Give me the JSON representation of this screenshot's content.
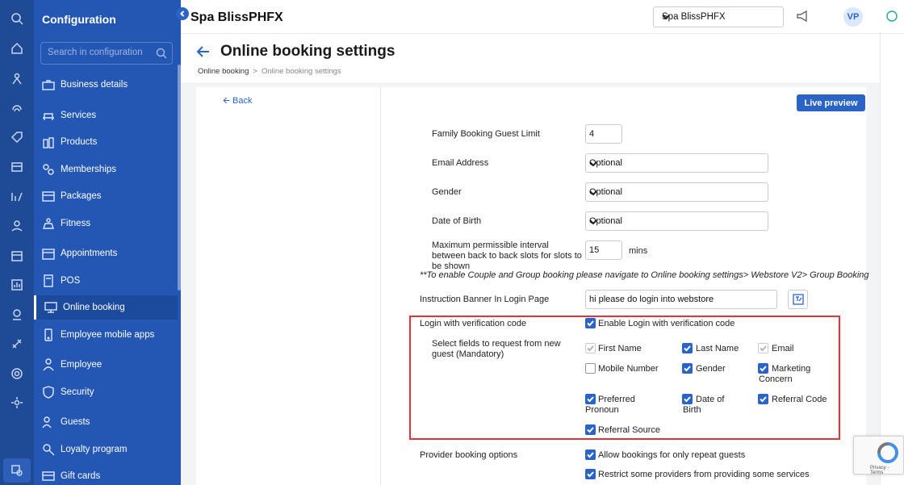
{
  "sidebar": {
    "title": "Configuration",
    "search_placeholder": "Search in configuration",
    "items": [
      {
        "label": "Business details",
        "icon": "briefcase-icon"
      },
      {
        "label": "Services",
        "icon": "services-icon"
      },
      {
        "label": "Products",
        "icon": "products-icon"
      },
      {
        "label": "Memberships",
        "icon": "memberships-icon"
      },
      {
        "label": "Packages",
        "icon": "packages-icon"
      },
      {
        "label": "Fitness",
        "icon": "fitness-icon"
      },
      {
        "label": "Appointments",
        "icon": "calendar-icon"
      },
      {
        "label": "POS",
        "icon": "pos-icon"
      },
      {
        "label": "Online booking",
        "icon": "monitor-icon"
      },
      {
        "label": "Employee mobile apps",
        "icon": "mobile-apps-icon"
      },
      {
        "label": "Employee",
        "icon": "employee-icon"
      },
      {
        "label": "Security",
        "icon": "shield-icon"
      },
      {
        "label": "Guests",
        "icon": "guests-icon"
      },
      {
        "label": "Loyalty program",
        "icon": "loyalty-icon"
      },
      {
        "label": "Gift cards",
        "icon": "gift-card-icon"
      }
    ],
    "active_item": "Online booking"
  },
  "header": {
    "brand": "Spa BlissPHFX",
    "location_select": "Spa BlissPHFX",
    "avatar_initials": "VP"
  },
  "page": {
    "title": "Online booking settings",
    "breadcrumb": [
      "Online booking",
      "Online booking settings"
    ],
    "back_link": "Back",
    "live_preview": "Live preview"
  },
  "form": {
    "family_limit": {
      "label": "Family Booking Guest Limit",
      "value": "4"
    },
    "email": {
      "label": "Email Address",
      "value": "Optional"
    },
    "gender": {
      "label": "Gender",
      "value": "Optional"
    },
    "dob": {
      "label": "Date of Birth",
      "value": "Optional"
    },
    "interval": {
      "label": "Maximum permissible interval between back to back slots for slots to be shown",
      "value": "15",
      "unit": "mins"
    },
    "note": "**To enable Couple and Group booking please navigate to Online booking settings> Webstore V2> Group Booking",
    "banner": {
      "label": "Instruction Banner In Login Page",
      "value": "hi please do login into webstore"
    },
    "login_verification": {
      "label": "Login with verification code",
      "enable_label": "Enable Login with verification code",
      "fields_label": "Select fields to request from new guest (Mandatory)",
      "fields": [
        {
          "label": "First Name",
          "state": "disabled"
        },
        {
          "label": "Last Name",
          "state": "checked"
        },
        {
          "label": "Email",
          "state": "disabled"
        },
        {
          "label": "Mobile Number",
          "state": "unchecked"
        },
        {
          "label": "Gender",
          "state": "checked"
        },
        {
          "label": "Marketing Concern",
          "state": "checked"
        },
        {
          "label": "Preferred Pronoun",
          "state": "checked"
        },
        {
          "label": "Date of Birth",
          "state": "checked"
        },
        {
          "label": "Referral Code",
          "state": "checked"
        },
        {
          "label": "Referral Source",
          "state": "checked"
        }
      ]
    },
    "provider": {
      "label": "Provider booking options",
      "opt1": "Allow bookings for only repeat guests",
      "opt2": "Restrict some providers from providing some services"
    }
  },
  "recaptcha": {
    "text": "Privacy - Terms"
  },
  "colors": {
    "sidebar": "#2357b3",
    "rail": "#1f4a96",
    "accent": "#2b64c7",
    "highlight": "#e0353b"
  }
}
